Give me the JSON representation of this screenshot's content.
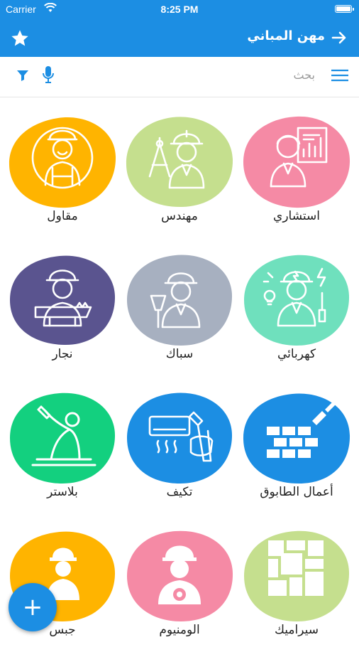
{
  "status_bar": {
    "carrier": "Carrier",
    "time": "8:25 PM"
  },
  "header": {
    "title": "مهن المباني"
  },
  "search": {
    "placeholder": "بحث"
  },
  "tiles": [
    {
      "label": "استشاري",
      "color": "#f58aa5",
      "icon": "consultant-icon"
    },
    {
      "label": "مهندس",
      "color": "#c5df8e",
      "icon": "engineer-icon"
    },
    {
      "label": "مقاول",
      "color": "#ffb400",
      "icon": "contractor-icon"
    },
    {
      "label": "كهربائي",
      "color": "#6fe0bd",
      "icon": "electrician-icon"
    },
    {
      "label": "سباك",
      "color": "#a7b0c0",
      "icon": "plumber-icon"
    },
    {
      "label": "نجار",
      "color": "#5a548f",
      "icon": "carpenter-icon"
    },
    {
      "label": "أعمال الطابوق",
      "color": "#1c8ee3",
      "icon": "bricklaying-icon"
    },
    {
      "label": "تكيف",
      "color": "#1c8ee3",
      "icon": "air-conditioning-icon"
    },
    {
      "label": "بلاستر",
      "color": "#13d07f",
      "icon": "plaster-icon"
    },
    {
      "label": "سيراميك",
      "color": "#c5df8e",
      "icon": "ceramic-icon"
    },
    {
      "label": "الومنيوم",
      "color": "#f58aa5",
      "icon": "aluminum-icon"
    },
    {
      "label": "جبس",
      "color": "#ffb400",
      "icon": "gypsum-icon"
    }
  ],
  "fab": {
    "label": "+"
  }
}
